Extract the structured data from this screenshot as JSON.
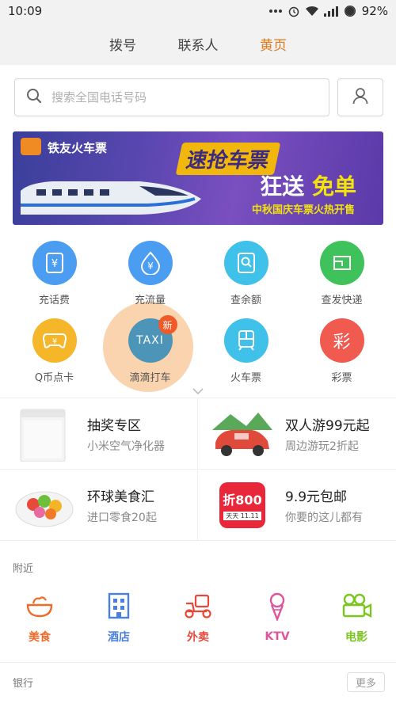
{
  "status_bar": {
    "time": "10:09",
    "battery": "92%"
  },
  "tabs": [
    {
      "label": "拨号",
      "active": false
    },
    {
      "label": "联系人",
      "active": false
    },
    {
      "label": "黄页",
      "active": true
    }
  ],
  "search": {
    "placeholder": "搜索全国电话号码"
  },
  "banner": {
    "brand": "铁友火车票",
    "headline1": "速抢车票",
    "headline2_prefix": "狂送",
    "headline2_highlight": "免单",
    "subline": "中秋国庆车票火热开售"
  },
  "services": [
    {
      "label": "充话费",
      "icon": "yuan-card-icon",
      "color": "#4b9df2"
    },
    {
      "label": "充流量",
      "icon": "yuan-drop-icon",
      "color": "#4b9df2"
    },
    {
      "label": "查余额",
      "icon": "search-doc-icon",
      "color": "#3fc1ea"
    },
    {
      "label": "查发快递",
      "icon": "express-box-icon",
      "color": "#3fc25b"
    },
    {
      "label": "Q币点卡",
      "icon": "gamepad-icon",
      "color": "#f6b62a"
    },
    {
      "label": "滴滴打车",
      "icon": "taxi-icon",
      "color": "#4c95b8",
      "badge": "新",
      "icon_text": "TAXI"
    },
    {
      "label": "火车票",
      "icon": "train-icon",
      "color": "#3fc1ea"
    },
    {
      "label": "彩票",
      "icon": "lottery-icon",
      "color": "#f05a4f",
      "icon_text": "彩"
    }
  ],
  "promos": [
    {
      "title": "抽奖专区",
      "subtitle": "小米空气净化器",
      "thumb": "air-purifier"
    },
    {
      "title": "双人游99元起",
      "subtitle": "周边游玩2折起",
      "thumb": "red-car"
    },
    {
      "title": "环球美食汇",
      "subtitle": "进口零食20起",
      "thumb": "snack-bowl"
    },
    {
      "title": "9.9元包邮",
      "subtitle": "你要的这儿都有",
      "thumb": "zhe800-logo",
      "logo_text": "折800",
      "logo_sub": "天天 11.11"
    }
  ],
  "nearby": {
    "title": "附近",
    "items": [
      {
        "label": "美食",
        "icon": "food-bowl-icon",
        "color": "#f06b2a"
      },
      {
        "label": "酒店",
        "icon": "hotel-icon",
        "color": "#4a7fe0"
      },
      {
        "label": "外卖",
        "icon": "delivery-scooter-icon",
        "color": "#e8483a"
      },
      {
        "label": "KTV",
        "icon": "ice-cream-mic-icon",
        "color": "#e0559a"
      },
      {
        "label": "电影",
        "icon": "movie-camera-icon",
        "color": "#7cc520"
      }
    ]
  },
  "bank": {
    "title": "银行",
    "more_label": "更多"
  }
}
